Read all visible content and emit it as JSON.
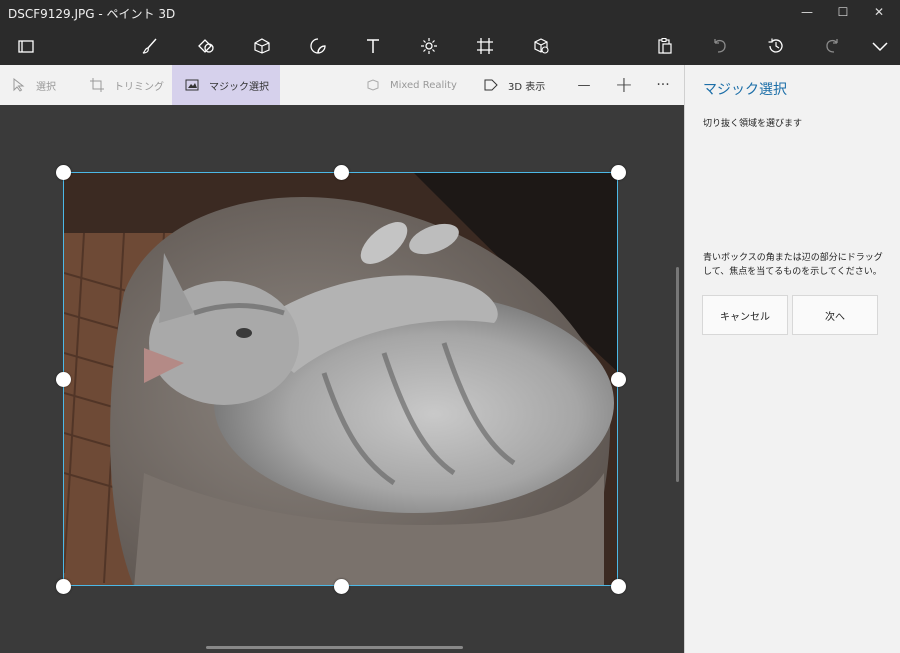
{
  "window": {
    "title": "DSCF9129.JPG - ペイント 3D",
    "controls": {
      "minimize": "—",
      "maximize": "☐",
      "close": "✕"
    }
  },
  "main_toolbar": {
    "icons": [
      "menu-icon",
      "brush-icon",
      "2d-shapes-icon",
      "3d-shapes-icon",
      "stickers-icon",
      "text-icon",
      "effects-icon",
      "canvas-icon",
      "3d-library-icon",
      "paste-icon",
      "undo-icon",
      "history-icon",
      "redo-icon",
      "expand-icon"
    ]
  },
  "sub_toolbar": {
    "select_label": "選択",
    "crop_label": "トリミング",
    "magic_select_label": "マジック選択",
    "mixed_reality_label": "Mixed Reality",
    "view3d_label": "3D 表示",
    "zoom_out": "—",
    "zoom_in": "+",
    "more": "···"
  },
  "panel": {
    "title": "マジック選択",
    "subtitle": "切り抜く領域を選びます",
    "info": "青いボックスの角または辺の部分にドラッグして、焦点を当てるものを示してください。",
    "cancel_label": "キャンセル",
    "next_label": "次へ"
  },
  "colors": {
    "accent": "#1b6ea8",
    "selection_border": "#4cb8e6",
    "active_tool_bg": "#d6d1ec",
    "annotation_arrow": "#6fe3e8"
  }
}
